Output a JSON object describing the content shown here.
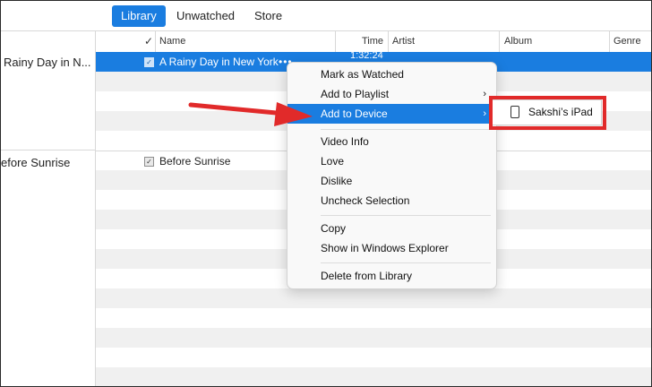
{
  "tabs": [
    {
      "label": "Library",
      "active": true
    },
    {
      "label": "Unwatched",
      "active": false
    },
    {
      "label": "Store",
      "active": false
    }
  ],
  "left_pane": {
    "entries": [
      "Rainy Day in N...",
      "efore Sunrise"
    ]
  },
  "columns": {
    "check": "✓",
    "name": "Name",
    "time": "Time",
    "artist": "Artist",
    "album": "Album",
    "genre": "Genre"
  },
  "rows": [
    {
      "checked": true,
      "name": "A Rainy Day in New York",
      "time": "1:32:24",
      "selected": true
    },
    {
      "checked": true,
      "name": "Before Sunrise",
      "time": "",
      "selected": false
    }
  ],
  "context_menu": {
    "groups": [
      [
        {
          "label": "Mark as Watched",
          "submenu": false,
          "highlighted": false
        },
        {
          "label": "Add to Playlist",
          "submenu": true,
          "highlighted": false
        },
        {
          "label": "Add to Device",
          "submenu": true,
          "highlighted": true
        }
      ],
      [
        {
          "label": "Video Info",
          "submenu": false,
          "highlighted": false
        },
        {
          "label": "Love",
          "submenu": false,
          "highlighted": false
        },
        {
          "label": "Dislike",
          "submenu": false,
          "highlighted": false
        },
        {
          "label": "Uncheck Selection",
          "submenu": false,
          "highlighted": false
        }
      ],
      [
        {
          "label": "Copy",
          "submenu": false,
          "highlighted": false
        },
        {
          "label": "Show in Windows Explorer",
          "submenu": false,
          "highlighted": false
        }
      ],
      [
        {
          "label": "Delete from Library",
          "submenu": false,
          "highlighted": false
        }
      ]
    ]
  },
  "device_submenu": {
    "device_name": "Sakshi’s iPad",
    "icon": "ipad-icon"
  },
  "annotation": {
    "color": "#e12a2a",
    "arrow_icon": "red-arrow-icon"
  },
  "colors": {
    "accent": "#1a7de0",
    "annotation": "#e12a2a"
  }
}
